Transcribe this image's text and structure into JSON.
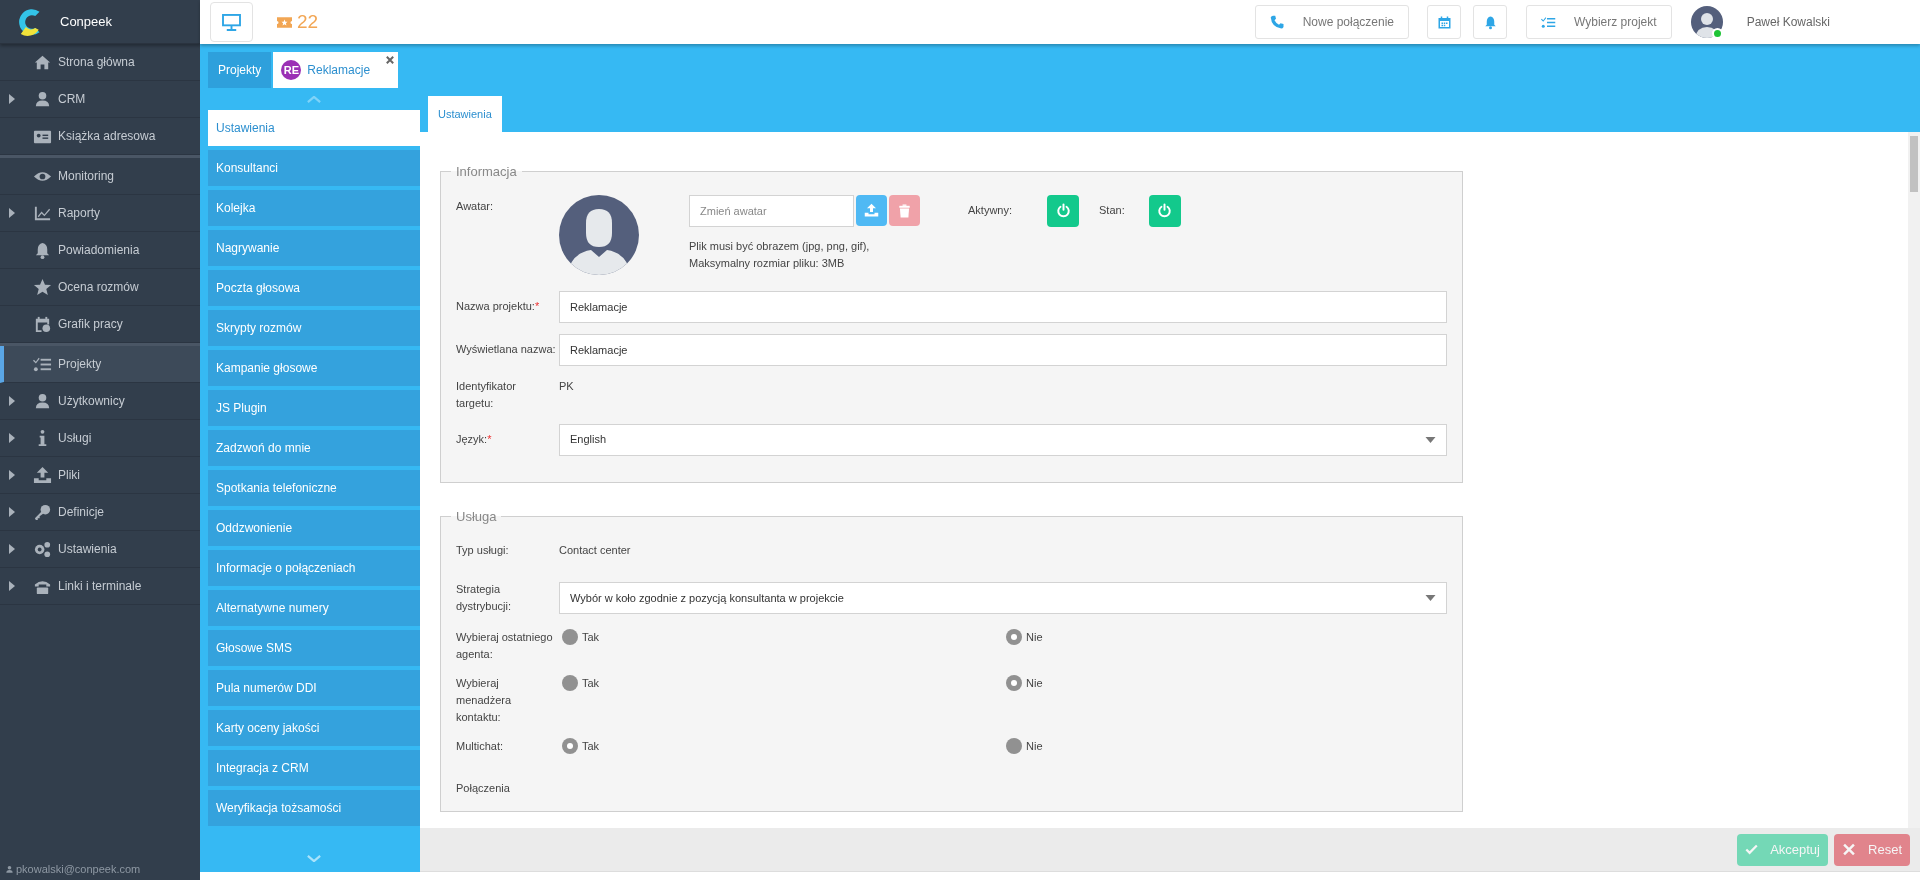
{
  "brand": "Conpeek",
  "topbar": {
    "ticket_count": "22",
    "actions": [
      {
        "kind": "button",
        "label": "Nowe połączenie"
      },
      {
        "kind": "icon"
      },
      {
        "kind": "icon"
      },
      {
        "kind": "button",
        "label": "Wybierz projekt"
      }
    ],
    "user": {
      "name": "Paweł Kowalski",
      "online": true
    }
  },
  "sidebar": {
    "groups": [
      {
        "items": [
          {
            "label": "Strona główna",
            "expandable": false,
            "selected": false
          },
          {
            "label": "CRM",
            "expandable": true,
            "selected": false
          },
          {
            "label": "Książka adresowa",
            "expandable": false,
            "selected": false
          }
        ]
      },
      {
        "items": [
          {
            "label": "Monitoring",
            "expandable": false,
            "selected": false
          },
          {
            "label": "Raporty",
            "expandable": true,
            "selected": false
          },
          {
            "label": "Powiadomienia",
            "expandable": false,
            "selected": false
          },
          {
            "label": "Ocena rozmów",
            "expandable": false,
            "selected": false
          },
          {
            "label": "Grafik pracy",
            "expandable": false,
            "selected": false
          }
        ]
      },
      {
        "items": [
          {
            "label": "Projekty",
            "expandable": false,
            "selected": true
          },
          {
            "label": "Użytkownicy",
            "expandable": true,
            "selected": false
          },
          {
            "label": "Usługi",
            "expandable": true,
            "selected": false
          },
          {
            "label": "Pliki",
            "expandable": true,
            "selected": false
          },
          {
            "label": "Definicje",
            "expandable": true,
            "selected": false
          },
          {
            "label": "Ustawienia",
            "expandable": true,
            "selected": false
          },
          {
            "label": "Linki i terminale",
            "expandable": true,
            "selected": false
          }
        ]
      }
    ],
    "footer_email": "pkowalski@conpeek.com"
  },
  "project_tabs": [
    {
      "label": "Projekty",
      "selected": false
    },
    {
      "label": "Reklamacje",
      "badge": "RE",
      "selected": true
    }
  ],
  "section_menu": [
    {
      "label": "Ustawienia",
      "selected": true
    },
    {
      "label": "Konsultanci",
      "selected": false
    },
    {
      "label": "Kolejka",
      "selected": false
    },
    {
      "label": "Nagrywanie",
      "selected": false
    },
    {
      "label": "Poczta głosowa",
      "selected": false
    },
    {
      "label": "Skrypty rozmów",
      "selected": false
    },
    {
      "label": "Kampanie głosowe",
      "selected": false
    },
    {
      "label": "JS Plugin",
      "selected": false
    },
    {
      "label": "Zadzwoń do mnie",
      "selected": false
    },
    {
      "label": "Spotkania telefoniczne",
      "selected": false
    },
    {
      "label": "Oddzwonienie",
      "selected": false
    },
    {
      "label": "Informacje o połączeniach",
      "selected": false
    },
    {
      "label": "Alternatywne numery",
      "selected": false
    },
    {
      "label": "Głosowe SMS",
      "selected": false
    },
    {
      "label": "Pula numerów DDI",
      "selected": false
    },
    {
      "label": "Karty oceny jakości",
      "selected": false
    },
    {
      "label": "Integracja z CRM",
      "selected": false
    },
    {
      "label": "Weryfikacja tożsamości",
      "selected": false
    }
  ],
  "content_tabs": [
    {
      "label": "Ustawienia",
      "selected": true
    }
  ],
  "informacja": {
    "legend": "Informacja",
    "avatar": {
      "label": "Awatar:",
      "placeholder": "Zmień awatar",
      "hint_lines": [
        "Plik musi być obrazem (jpg, png, gif),",
        "Maksymalny rozmiar pliku: 3MB"
      ]
    },
    "toggles": [
      {
        "label": "Aktywny:",
        "on": true
      },
      {
        "label": "Stan:",
        "on": true
      }
    ],
    "fields": [
      {
        "kind": "input",
        "label": "Nazwa projektu:",
        "required_mark": "*",
        "value": "Reklamacje"
      },
      {
        "kind": "input",
        "label": "Wyświetlana nazwa:",
        "value": "Reklamacje"
      },
      {
        "kind": "text",
        "label": "Identyfikator targetu:",
        "value": "PK"
      },
      {
        "kind": "select",
        "label": "Język:",
        "required_mark": "*",
        "value": "English"
      }
    ]
  },
  "usluga": {
    "legend": "Usługa",
    "fields": [
      {
        "kind": "text",
        "label": "Typ usługi:",
        "value": "Contact center"
      },
      {
        "kind": "select",
        "label": "Strategia dystrybucji:",
        "value": "Wybór w koło zgodnie z pozycją konsultanta w projekcie"
      },
      {
        "kind": "radio",
        "label": "Wybieraj ostatniego agenta:",
        "options": [
          {
            "label": "Tak",
            "selected": false
          },
          {
            "label": "Nie",
            "selected": true
          }
        ]
      },
      {
        "kind": "radio",
        "label": "Wybieraj menadżera kontaktu:",
        "options": [
          {
            "label": "Tak",
            "selected": false
          },
          {
            "label": "Nie",
            "selected": true
          }
        ]
      },
      {
        "kind": "radio",
        "label": "Multichat:",
        "options": [
          {
            "label": "Tak",
            "selected": true
          },
          {
            "label": "Nie",
            "selected": false
          }
        ]
      },
      {
        "kind": "label",
        "label": "Połączenia"
      }
    ]
  },
  "footer_buttons": [
    {
      "kind": "accept",
      "label": "Akceptuj",
      "disabled": true
    },
    {
      "kind": "reset",
      "label": "Reset",
      "disabled": true
    }
  ]
}
